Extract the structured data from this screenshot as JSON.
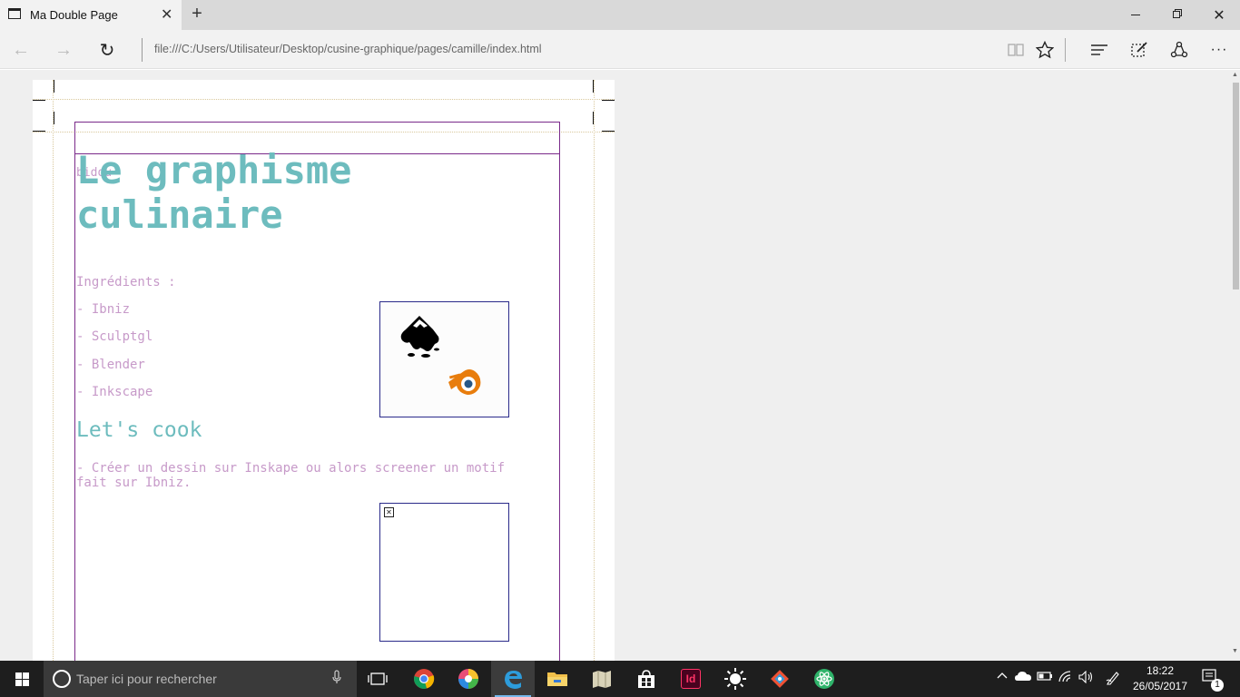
{
  "browser": {
    "tab": {
      "title": "Ma Double Page",
      "close": "✕"
    },
    "new_tab": "+",
    "window": {
      "minimize": "",
      "restore": "",
      "close": "✕"
    },
    "nav": {
      "back": "←",
      "forward": "→",
      "refresh": "↻"
    },
    "address": "file:///C:/Users/Utilisateur/Desktop/cusine-graphique/pages/camille/index.html",
    "toolbar_icons": [
      "reading-view-icon",
      "favorite-star-icon",
      "hub-icon",
      "web-note-icon",
      "share-icon",
      "more-icon"
    ],
    "more": "···"
  },
  "document": {
    "overlap_label": "bidou",
    "title": "Le graphisme culinaire",
    "ingredients_title": "Ingrédients :",
    "ingredients": [
      "- Ibniz",
      "- Sculptgl",
      "- Blender",
      "- Inkscape"
    ],
    "section_title": "Let's cook",
    "steps": [
      "- Créer un dessin sur Inskape ou alors screener un motif fait sur Ibniz."
    ],
    "images": [
      {
        "name": "inkscape-blender-logos",
        "icons": [
          "inkscape-icon",
          "blender-icon"
        ]
      },
      {
        "name": "broken-image",
        "icons": [
          "broken-image-icon"
        ]
      }
    ],
    "colors": {
      "title": "#6dbcbe",
      "text": "#c79ac9",
      "frame": "#7a2a8a",
      "image_border": "#2a2a8a",
      "guide": "#d9c89c"
    }
  },
  "taskbar": {
    "search_placeholder": "Taper ici pour rechercher",
    "apps": [
      "task-view-icon",
      "chrome-icon",
      "colorful-app-icon",
      "edge-icon",
      "file-explorer-icon",
      "maps-icon",
      "store-icon",
      "indesign-icon",
      "sun-app-icon",
      "git-icon",
      "atom-icon"
    ],
    "indesign_label": "Id",
    "time": "18:22",
    "date": "26/05/2017",
    "notifications": "1"
  }
}
